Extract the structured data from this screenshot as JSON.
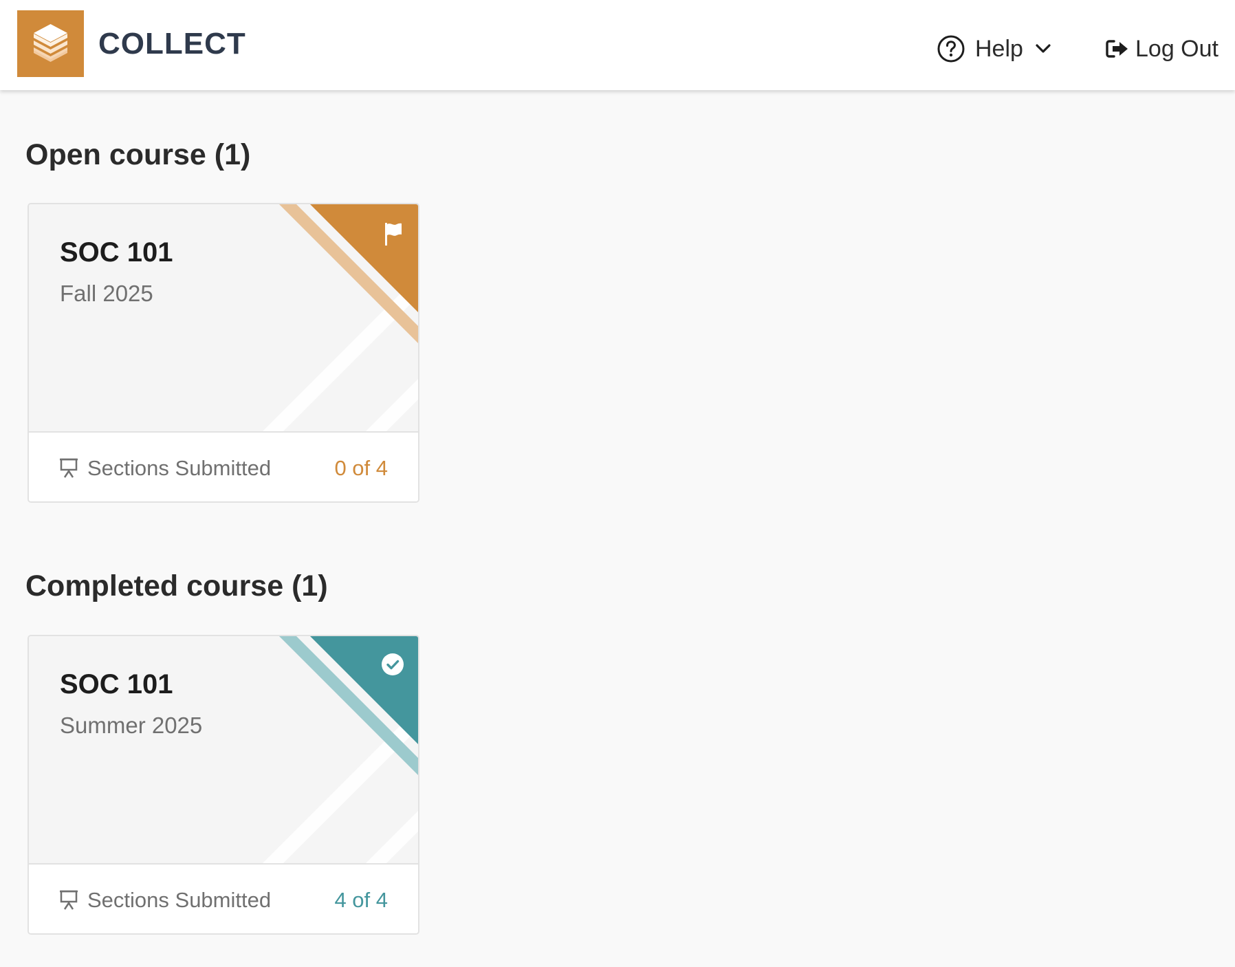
{
  "header": {
    "brand": "COLLECT",
    "help_label": "Help",
    "logout_label": "Log Out"
  },
  "colors": {
    "brand_orange": "#d08a3a",
    "orange_light": "#e8c298",
    "teal": "#44969d",
    "teal_light": "#9ccacd",
    "navy": "#2f3a4c"
  },
  "sections": [
    {
      "heading": "Open course (1)",
      "courses": [
        {
          "title": "SOC 101",
          "term": "Fall 2025",
          "status_icon": "flag-icon",
          "footer_label": "Sections Submitted",
          "footer_count": "0 of 4"
        }
      ]
    },
    {
      "heading": "Completed course (1)",
      "courses": [
        {
          "title": "SOC 101",
          "term": "Summer 2025",
          "status_icon": "check-circle-icon",
          "footer_label": "Sections Submitted",
          "footer_count": "4 of 4"
        }
      ]
    }
  ]
}
